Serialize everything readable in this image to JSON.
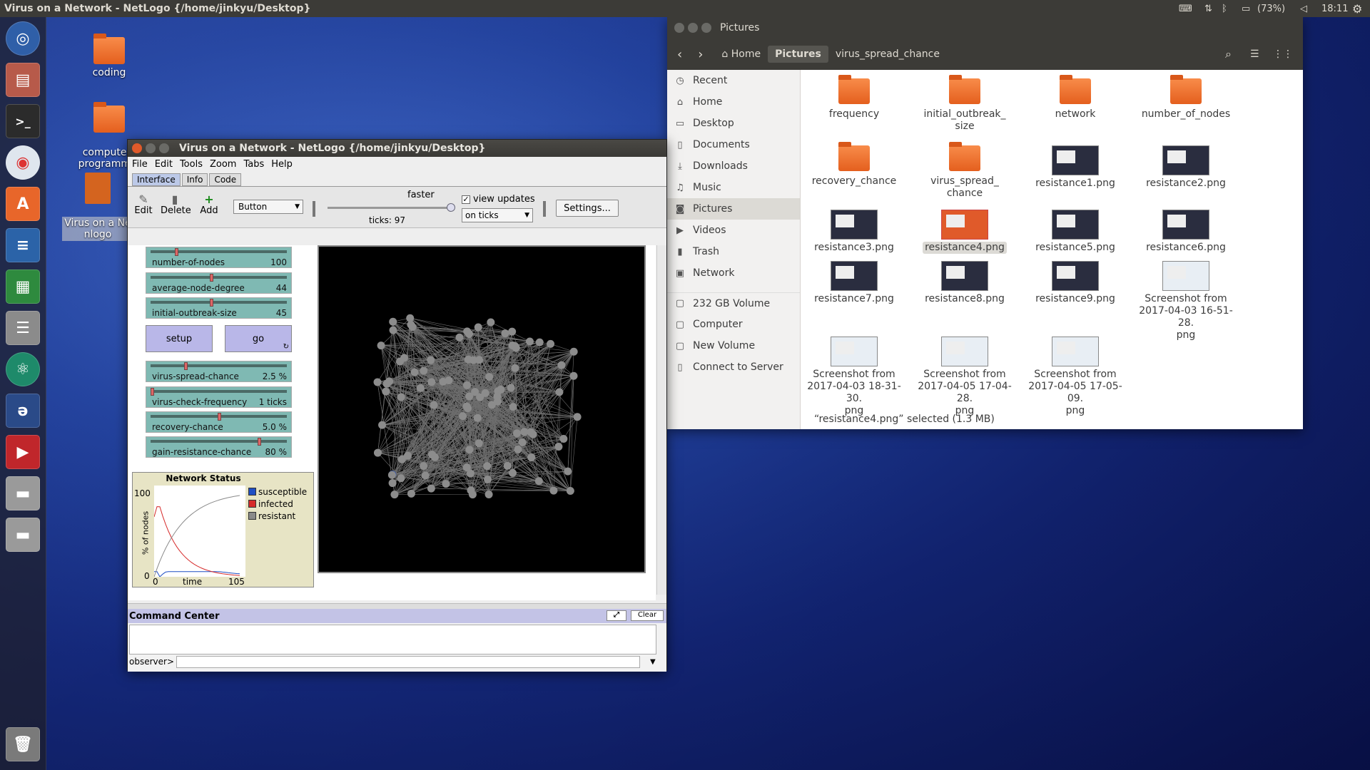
{
  "top_panel": {
    "title": "Virus on a Network - NetLogo {/home/jinkyu/Desktop}",
    "battery": "(73%)",
    "clock": "18:11"
  },
  "desktop": {
    "icons": [
      {
        "label": "coding"
      },
      {
        "label": "computer_\nprogramm..."
      },
      {
        "label": "Virus on a Ne\nnlogo"
      }
    ]
  },
  "netlogo": {
    "title": "Virus on a Network - NetLogo {/home/jinkyu/Desktop}",
    "menu": [
      "File",
      "Edit",
      "Tools",
      "Zoom",
      "Tabs",
      "Help"
    ],
    "tabs": [
      "Interface",
      "Info",
      "Code"
    ],
    "toolbar": {
      "edit": "Edit",
      "delete": "Delete",
      "add": "Add",
      "widget_type": "Button",
      "speed_label": "faster",
      "ticks_label": "ticks: 97",
      "view_updates": "view updates",
      "update_mode": "on ticks",
      "settings": "Settings..."
    },
    "sliders": [
      {
        "label": "number-of-nodes",
        "value": "100",
        "fraction": 0.18
      },
      {
        "label": "average-node-degree",
        "value": "44",
        "fraction": 0.44
      },
      {
        "label": "initial-outbreak-size",
        "value": "45",
        "fraction": 0.44
      },
      {
        "label": "virus-spread-chance",
        "value": "2.5 %",
        "fraction": 0.25
      },
      {
        "label": "virus-check-frequency",
        "value": "1 ticks",
        "fraction": 0.0
      },
      {
        "label": "recovery-chance",
        "value": "5.0 %",
        "fraction": 0.5
      },
      {
        "label": "gain-resistance-chance",
        "value": "80 %",
        "fraction": 0.8
      }
    ],
    "buttons": {
      "setup": "setup",
      "go": "go"
    },
    "plot": {
      "title": "Network Status",
      "ylabel": "% of nodes",
      "xlabel": "time",
      "ymax": "100",
      "ymin": "0",
      "xmin": "0",
      "xmax": "105",
      "legend": [
        {
          "name": "susceptible",
          "color": "#1f4fc4"
        },
        {
          "name": "infected",
          "color": "#d62a2a"
        },
        {
          "name": "resistant",
          "color": "#8a8a8a"
        }
      ]
    },
    "command_center": {
      "title": "Command Center",
      "clear": "Clear",
      "prompt": "observer>"
    }
  },
  "files": {
    "window_title": "Pictures",
    "breadcrumb": [
      "Home",
      "Pictures",
      "virus_spread_chance"
    ],
    "sidebar": [
      {
        "label": "Recent",
        "icon": "clock-icon"
      },
      {
        "label": "Home",
        "icon": "home-icon"
      },
      {
        "label": "Desktop",
        "icon": "folder-icon"
      },
      {
        "label": "Documents",
        "icon": "document-icon"
      },
      {
        "label": "Downloads",
        "icon": "download-icon"
      },
      {
        "label": "Music",
        "icon": "music-icon"
      },
      {
        "label": "Pictures",
        "icon": "camera-icon"
      },
      {
        "label": "Videos",
        "icon": "video-icon"
      },
      {
        "label": "Trash",
        "icon": "trash-icon"
      },
      {
        "label": "Network",
        "icon": "network-icon"
      },
      {
        "label": "232 GB Volume",
        "icon": "drive-icon"
      },
      {
        "label": "Computer",
        "icon": "computer-icon"
      },
      {
        "label": "New Volume",
        "icon": "drive-icon"
      },
      {
        "label": "Connect to Server",
        "icon": "server-icon"
      }
    ],
    "items": [
      {
        "name": "frequency",
        "kind": "folder"
      },
      {
        "name": "initial_outbreak_\nsize",
        "kind": "folder"
      },
      {
        "name": "network",
        "kind": "folder"
      },
      {
        "name": "number_of_nodes",
        "kind": "folder"
      },
      {
        "name": "recovery_chance",
        "kind": "folder"
      },
      {
        "name": "virus_spread_\nchance",
        "kind": "folder"
      },
      {
        "name": "resistance1.png",
        "kind": "image"
      },
      {
        "name": "resistance2.png",
        "kind": "image"
      },
      {
        "name": "resistance3.png",
        "kind": "image"
      },
      {
        "name": "resistance4.png",
        "kind": "image-selected"
      },
      {
        "name": "resistance5.png",
        "kind": "image"
      },
      {
        "name": "resistance6.png",
        "kind": "image"
      },
      {
        "name": "resistance7.png",
        "kind": "image"
      },
      {
        "name": "resistance8.png",
        "kind": "image"
      },
      {
        "name": "resistance9.png",
        "kind": "image"
      },
      {
        "name": "Screenshot from\n2017-04-03 16-51-28.\npng",
        "kind": "image"
      },
      {
        "name": "Screenshot from\n2017-04-03 18-31-30.\npng",
        "kind": "image"
      },
      {
        "name": "Screenshot from\n2017-04-05 17-04-28.\npng",
        "kind": "image"
      },
      {
        "name": "Screenshot from\n2017-04-05 17-05-09.\npng",
        "kind": "image"
      }
    ],
    "status": "“resistance4.png” selected (1.3 MB)"
  }
}
